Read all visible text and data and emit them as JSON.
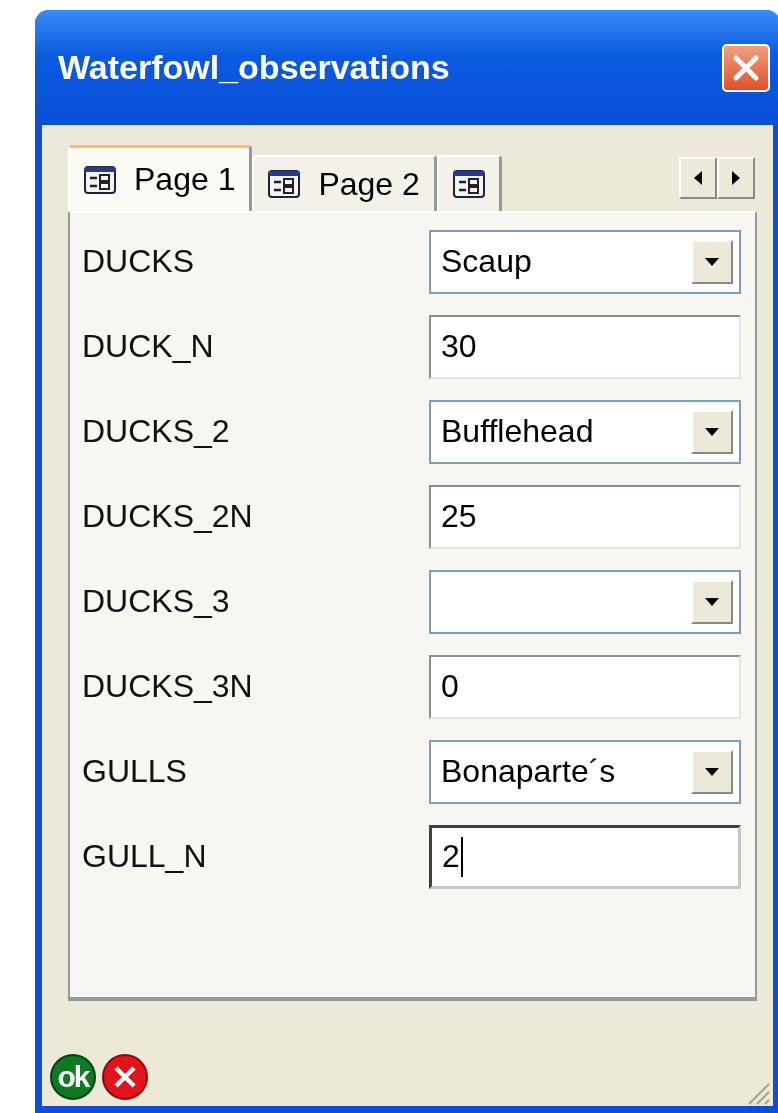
{
  "window": {
    "title": "Waterfowl_observations"
  },
  "tabs": [
    {
      "label": "Page 1",
      "selected": true
    },
    {
      "label": "Page 2",
      "selected": false
    },
    {
      "selected": false
    }
  ],
  "fields": [
    {
      "label": "DUCKS",
      "kind": "combo",
      "value": "Scaup",
      "focused": false
    },
    {
      "label": "DUCK_N",
      "kind": "text",
      "value": "30",
      "focused": false
    },
    {
      "label": "DUCKS_2",
      "kind": "combo",
      "value": "Bufflehead",
      "focused": false
    },
    {
      "label": "DUCKS_2N",
      "kind": "text",
      "value": "25",
      "focused": false
    },
    {
      "label": "DUCKS_3",
      "kind": "combo",
      "focused": false
    },
    {
      "label": "DUCKS_3N",
      "kind": "text",
      "value": "0",
      "focused": false
    },
    {
      "label": "GULLS",
      "kind": "combo",
      "value": "Bonaparte´s",
      "focused": false
    },
    {
      "label": "GULL_N",
      "kind": "text",
      "value": "2",
      "focused": true
    }
  ],
  "buttons": {
    "ok": "ok"
  }
}
